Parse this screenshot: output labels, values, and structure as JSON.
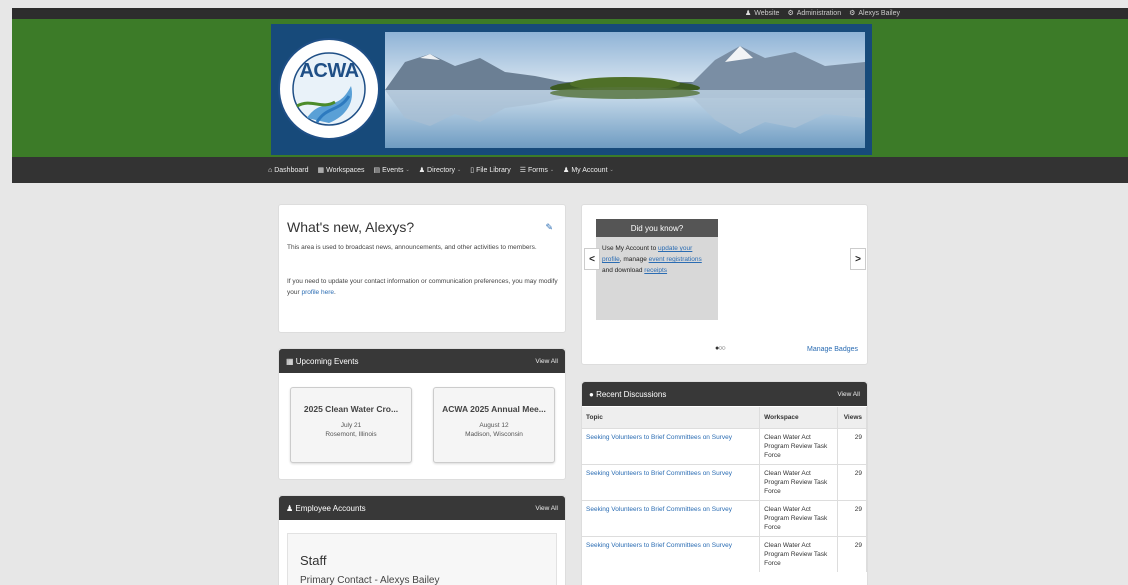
{
  "topbar": {
    "website": "Website",
    "administration": "Administration",
    "user": "Alexys Bailey"
  },
  "nav": {
    "items": [
      {
        "label": "Dashboard",
        "icon": "bank-icon",
        "caret": false
      },
      {
        "label": "Workspaces",
        "icon": "grid-icon",
        "caret": false
      },
      {
        "label": "Events",
        "icon": "calendar-icon",
        "caret": true
      },
      {
        "label": "Directory",
        "icon": "users-icon",
        "caret": true
      },
      {
        "label": "File Library",
        "icon": "file-icon",
        "caret": false
      },
      {
        "label": "Forms",
        "icon": "list-icon",
        "caret": true
      },
      {
        "label": "My Account",
        "icon": "user-icon",
        "caret": true
      }
    ]
  },
  "logo": {
    "acronym": "ACWA",
    "ring_text": "Association of Clean Water Administrators",
    "bottom_text": "The Voice of States & Interstates",
    "est": "Est. 1961"
  },
  "whats_new": {
    "title": "What's new, Alexys?",
    "para1": "This area is used to broadcast news, announcements, and other activities to members.",
    "para2_prefix": "If you need to update your contact information or communication preferences, you may modify your ",
    "para2_link": "profile here",
    "para2_suffix": "."
  },
  "did_you_know": {
    "title": "Did you know?",
    "t1": "Use My Account to ",
    "l1": "update your profile",
    "t2": ", manage ",
    "l2": "event registrations",
    "t3": " and download ",
    "l3": "receipts",
    "prev": "<",
    "next": ">",
    "dots": "●○○",
    "manage_badges": "Manage Badges"
  },
  "upcoming_events": {
    "title": "Upcoming Events",
    "view_all": "View All",
    "events": [
      {
        "title": "2025 Clean Water Cro...",
        "date": "July 21",
        "location": "Rosemont, Illinois"
      },
      {
        "title": "ACWA 2025 Annual Mee...",
        "date": "August 12",
        "location": "Madison, Wisconsin"
      }
    ]
  },
  "employee_accounts": {
    "title": "Employee Accounts",
    "view_all": "View All",
    "heading": "Staff",
    "subheading": "Primary Contact - Alexys Bailey"
  },
  "recent_discussions": {
    "title": "Recent Discussions",
    "view_all": "View All",
    "columns": [
      "Topic",
      "Workspace",
      "Views"
    ],
    "rows": [
      {
        "topic": "Seeking Volunteers to Brief Committees on Survey",
        "workspace": "Clean Water Act Program Review Task Force",
        "views": "29"
      },
      {
        "topic": "Seeking Volunteers to Brief Committees on Survey",
        "workspace": "Clean Water Act Program Review Task Force",
        "views": "29"
      },
      {
        "topic": "Seeking Volunteers to Brief Committees on Survey",
        "workspace": "Clean Water Act Program Review Task Force",
        "views": "29"
      },
      {
        "topic": "Seeking Volunteers to Brief Committees on Survey",
        "workspace": "Clean Water Act Program Review Task Force",
        "views": "29"
      }
    ]
  },
  "colors": {
    "banner_green": "#3c7b28",
    "dark_bar": "#333333",
    "link_blue": "#2a6cb3"
  }
}
